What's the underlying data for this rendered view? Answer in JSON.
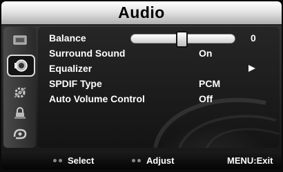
{
  "title": "Audio",
  "sidebar": {
    "icons": [
      {
        "name": "picture-icon",
        "glyph": "▬"
      },
      {
        "name": "audio-icon",
        "glyph": "♫"
      },
      {
        "name": "setup-icon",
        "glyph": "⚙"
      },
      {
        "name": "lock-icon",
        "glyph": "⌂"
      },
      {
        "name": "input-icon",
        "glyph": "⌱"
      }
    ],
    "selected_index": 1
  },
  "menu": {
    "balance": {
      "label": "Balance",
      "value": "0",
      "level": 0.48
    },
    "surround": {
      "label": "Surround Sound",
      "value": "On"
    },
    "equalizer": {
      "label": "Equalizer"
    },
    "spdif": {
      "label": "SPDIF Type",
      "value": "PCM"
    },
    "auto_volume": {
      "label": "Auto Volume Control",
      "value": "Off"
    }
  },
  "footer": {
    "select": "Select",
    "adjust": "Adjust",
    "menu_exit": "MENU:Exit"
  }
}
